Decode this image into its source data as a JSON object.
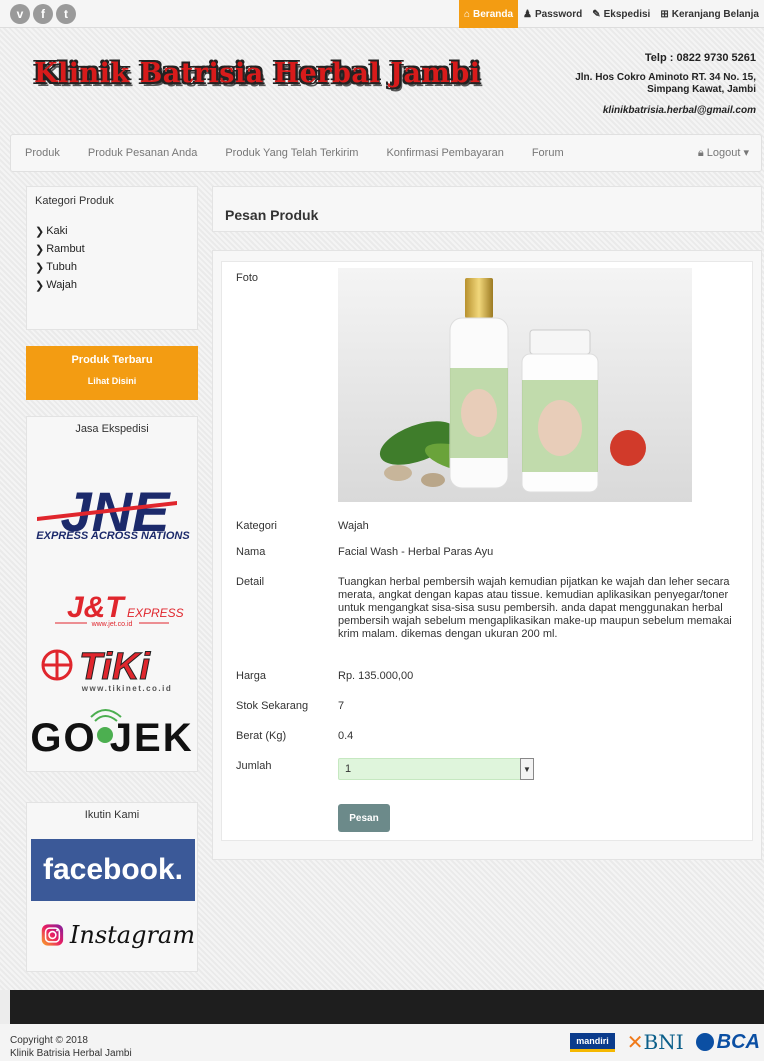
{
  "social": [
    "v",
    "f",
    "t"
  ],
  "topnav": {
    "home": "Beranda",
    "password": "Password",
    "shipping": "Ekspedisi",
    "cart": "Keranjang Belanja"
  },
  "header": {
    "brand": "Klinik Batrisia Herbal Jambi",
    "phone": "Telp : 0822 9730 5261",
    "address1": "Jln. Hos Cokro Aminoto RT. 34 No. 15,",
    "address2": "Simpang Kawat, Jambi",
    "email": "klinikbatrisia.herbal@gmail.com"
  },
  "nav": {
    "items": [
      "Produk",
      "Produk Pesanan Anda",
      "Produk Yang Telah Terkirim",
      "Konfirmasi Pembayaran",
      "Forum"
    ],
    "logout": "Logout"
  },
  "sidebar": {
    "category_title": "Kategori Produk",
    "categories": [
      "Kaki",
      "Rambut",
      "Tubuh",
      "Wajah"
    ],
    "new_title": "Produk Terbaru",
    "new_link": "Lihat Disini",
    "shipping_title": "Jasa Ekspedisi",
    "couriers": {
      "jne": "JNE",
      "jne_tag": "EXPRESS ACROSS NATIONS",
      "jnt": "J&T",
      "jnt_sub": "EXPRESS",
      "jnt_url": "www.jet.co.id",
      "tiki": "TiKi",
      "tiki_url": "www.tikinet.co.id",
      "gojek": "GO JEK"
    },
    "follow_title": "Ikutin Kami",
    "facebook": "facebook.",
    "instagram": "Instagram"
  },
  "main": {
    "title": "Pesan Produk",
    "labels": {
      "photo": "Foto",
      "category": "Kategori",
      "name": "Nama",
      "detail": "Detail",
      "price": "Harga",
      "stock": "Stok Sekarang",
      "weight": "Berat (Kg)",
      "qty": "Jumlah"
    },
    "product": {
      "category": "Wajah",
      "name": "Facial Wash - Herbal Paras Ayu",
      "detail": "Tuangkan herbal pembersih wajah kemudian pijatkan ke wajah dan leher secara merata, angkat dengan kapas atau tissue. kemudian aplikasikan penyegar/toner untuk mengangkat sisa-sisa susu pembersih. anda dapat menggunakan herbal pembersih wajah sebelum mengaplikasikan make-up maupun sebelum memakai krim malam. dikemas dengan ukuran 200 ml.",
      "price": "Rp. 135.000,00",
      "stock": "7",
      "weight": "0.4",
      "qty": "1"
    },
    "order_button": "Pesan"
  },
  "footer": {
    "copyright": "Copyright © 2018",
    "company": "Klinik Batrisia Herbal Jambi",
    "banks": [
      "mandiri",
      "BNI",
      "BCA"
    ]
  }
}
